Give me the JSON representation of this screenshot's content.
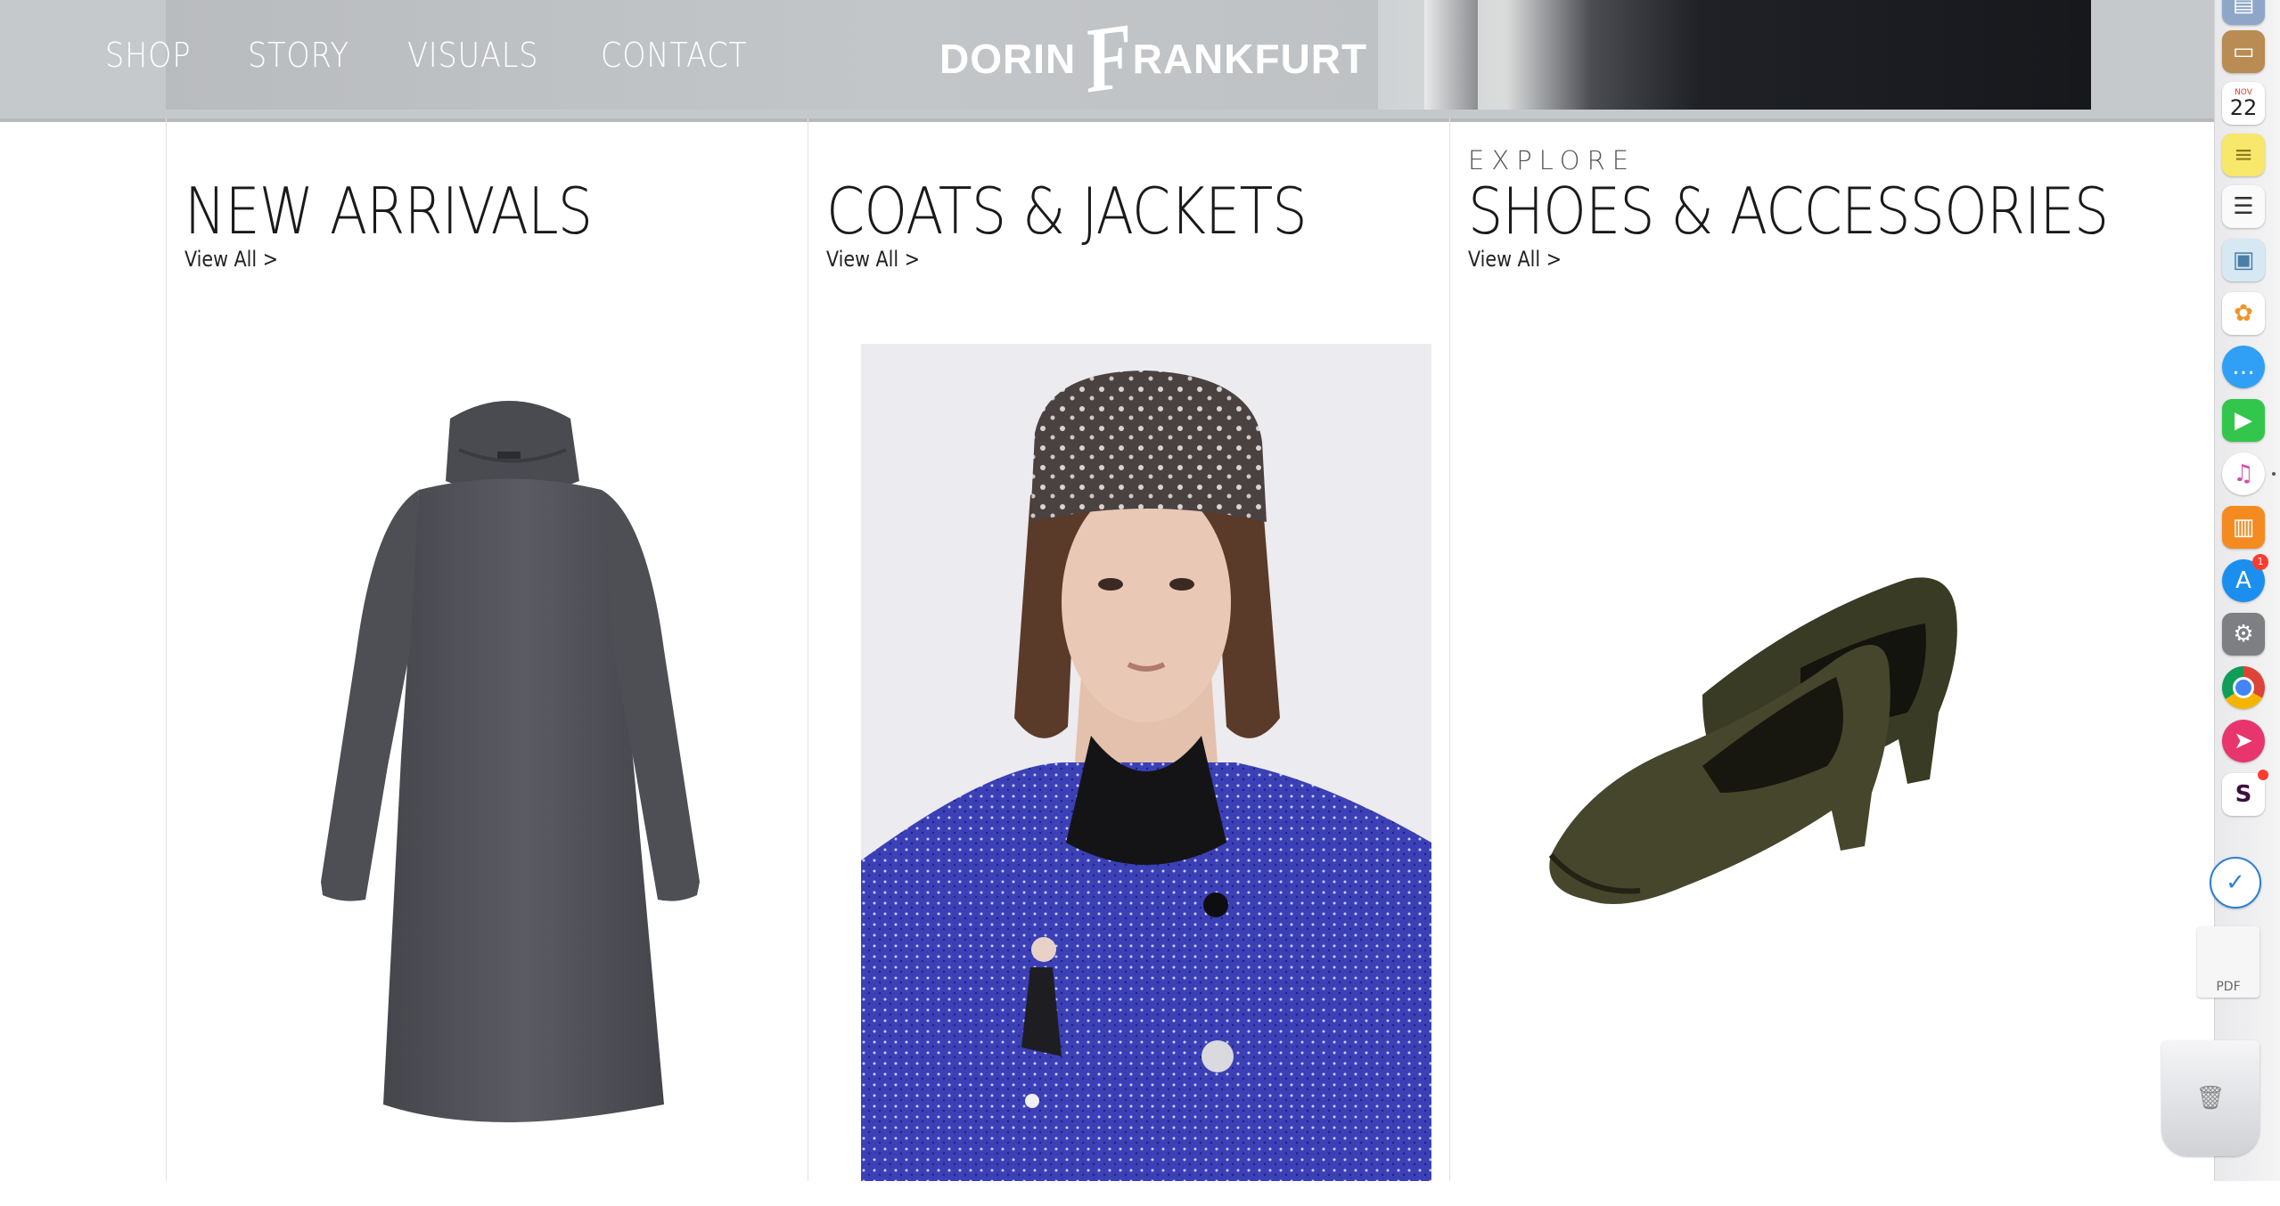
{
  "nav": {
    "links": [
      "SHOP",
      "STORY",
      "VISUALS",
      "CONTACT"
    ]
  },
  "logo": {
    "part1": "DORIN",
    "f_letter": "F",
    "part2": "RANKFURT"
  },
  "columns": [
    {
      "eyebrow": "",
      "title": "NEW ARRIVALS",
      "link": "View All >"
    },
    {
      "eyebrow": "",
      "title": "COATS & JACKETS",
      "link": "View All >"
    },
    {
      "eyebrow": "EXPLORE",
      "title": "SHOES & ACCESSORIES",
      "link": "View All >"
    }
  ],
  "dock": {
    "calendar_month": "NOV",
    "calendar_day": "22",
    "app_store_badge": "1",
    "pdf_label": "PDF",
    "icons": [
      "finder-folder-icon",
      "contacts-icon",
      "calendar-icon",
      "notes-icon",
      "reminders-icon",
      "preview-icon",
      "photos-icon",
      "messages-icon",
      "facetime-icon",
      "itunes-icon",
      "ibooks-icon",
      "app-store-icon",
      "system-preferences-icon",
      "chrome-icon",
      "airmail-icon",
      "slack-icon",
      "time-icon",
      "documents-stack-icon",
      "trash-icon"
    ]
  },
  "colors": {
    "hero_bg": "#c6c9cc",
    "nav_text": "#ffffff",
    "title_text": "#1a1a1a",
    "dress": "#55565c",
    "coat": "#3a3fb3",
    "shoe": "#3f4028"
  }
}
